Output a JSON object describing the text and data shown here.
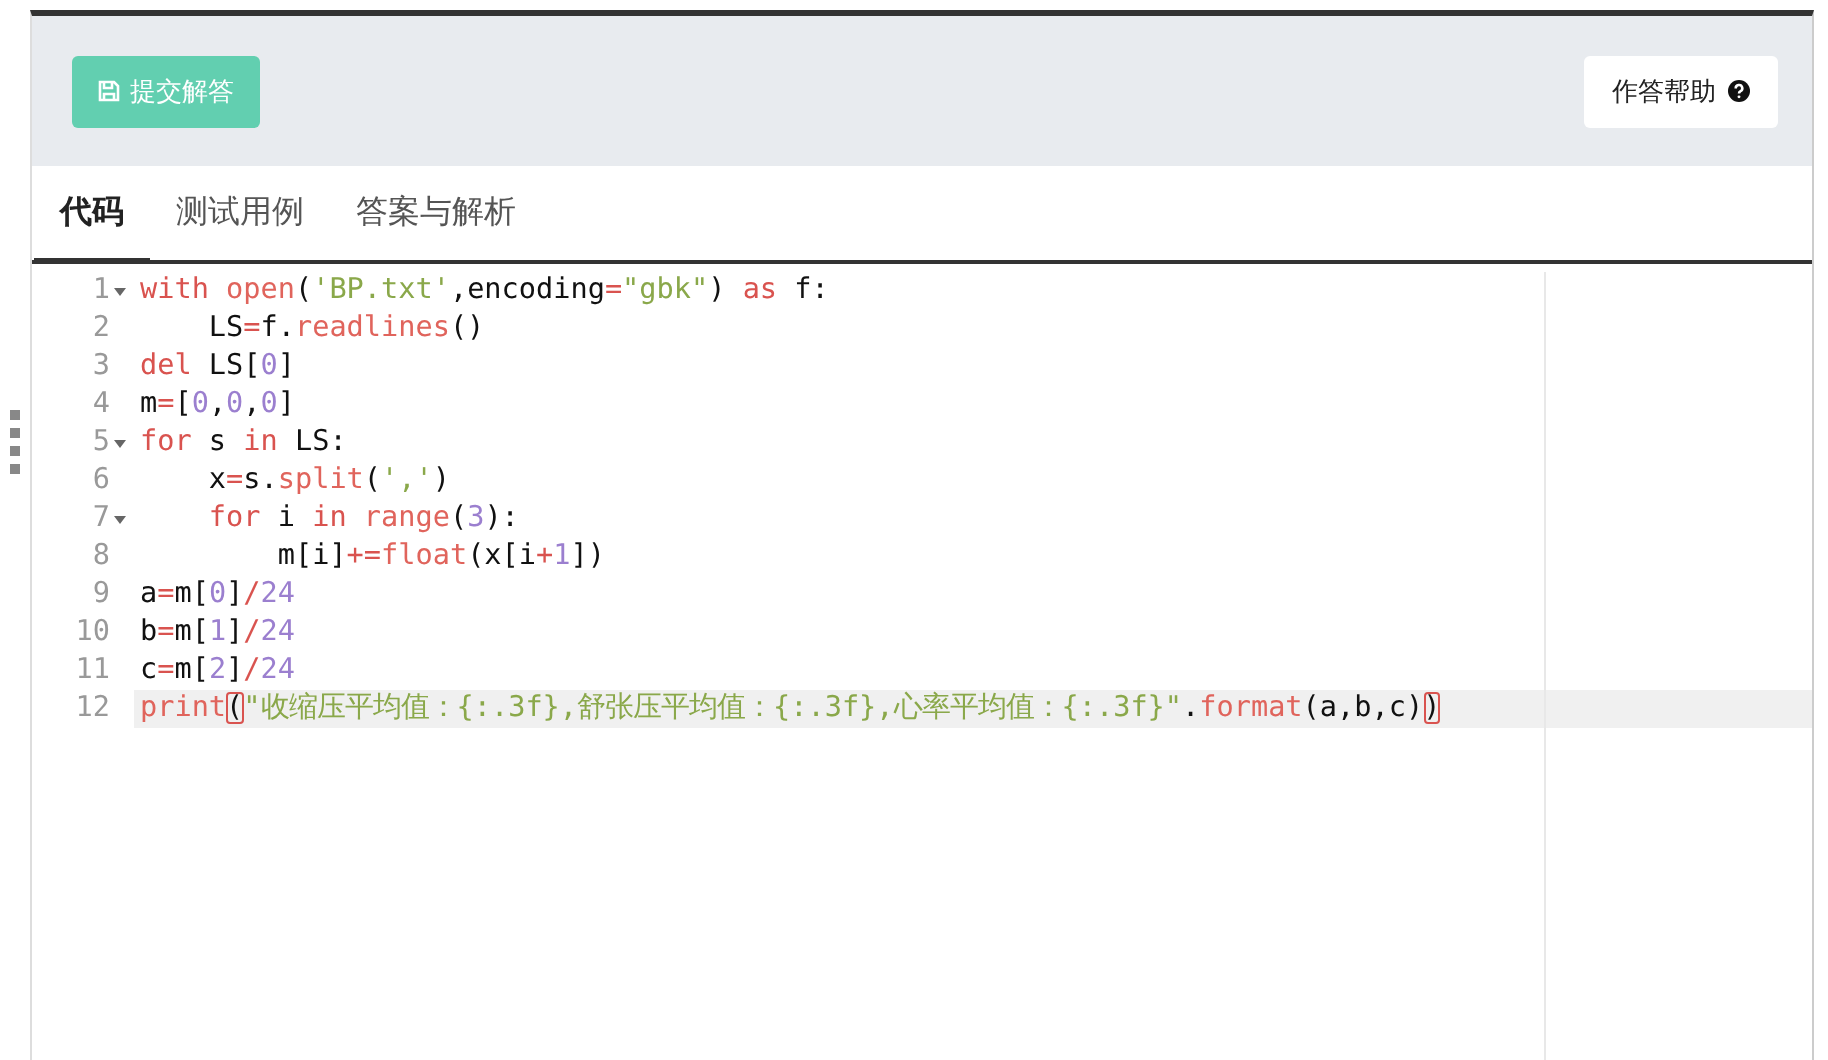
{
  "toolbar": {
    "submit_button": "提交解答",
    "help_button": "作答帮助"
  },
  "tabs": [
    {
      "label": "代码",
      "selected": true
    },
    {
      "label": "测试用例",
      "selected": false
    },
    {
      "label": "答案与解析",
      "selected": false
    }
  ],
  "editor": {
    "lines": [
      {
        "number": "1",
        "foldable": true,
        "active": false,
        "tokens": [
          {
            "kind": "keyword",
            "text": "with"
          },
          {
            "kind": "function",
            "text": " open"
          },
          {
            "kind": "plain",
            "text": "("
          },
          {
            "kind": "string",
            "text": "'BP.txt'"
          },
          {
            "kind": "plain",
            "text": ",encoding"
          },
          {
            "kind": "operator",
            "text": "="
          },
          {
            "kind": "string",
            "text": "\"gbk\""
          },
          {
            "kind": "plain",
            "text": ") "
          },
          {
            "kind": "keyword",
            "text": "as"
          },
          {
            "kind": "plain",
            "text": " f:"
          }
        ]
      },
      {
        "number": "2",
        "foldable": false,
        "active": false,
        "tokens": [
          {
            "kind": "plain",
            "text": "    LS"
          },
          {
            "kind": "operator",
            "text": "="
          },
          {
            "kind": "plain",
            "text": "f."
          },
          {
            "kind": "function",
            "text": "readlines"
          },
          {
            "kind": "plain",
            "text": "()"
          }
        ]
      },
      {
        "number": "3",
        "foldable": false,
        "active": false,
        "tokens": [
          {
            "kind": "keyword",
            "text": "del"
          },
          {
            "kind": "plain",
            "text": " LS["
          },
          {
            "kind": "number",
            "text": "0"
          },
          {
            "kind": "plain",
            "text": "]"
          }
        ]
      },
      {
        "number": "4",
        "foldable": false,
        "active": false,
        "tokens": [
          {
            "kind": "plain",
            "text": "m"
          },
          {
            "kind": "operator",
            "text": "="
          },
          {
            "kind": "plain",
            "text": "["
          },
          {
            "kind": "number",
            "text": "0"
          },
          {
            "kind": "plain",
            "text": ","
          },
          {
            "kind": "number",
            "text": "0"
          },
          {
            "kind": "plain",
            "text": ","
          },
          {
            "kind": "number",
            "text": "0"
          },
          {
            "kind": "plain",
            "text": "]"
          }
        ]
      },
      {
        "number": "5",
        "foldable": true,
        "active": false,
        "tokens": [
          {
            "kind": "keyword",
            "text": "for"
          },
          {
            "kind": "plain",
            "text": " s "
          },
          {
            "kind": "keyword",
            "text": "in"
          },
          {
            "kind": "plain",
            "text": " LS:"
          }
        ]
      },
      {
        "number": "6",
        "foldable": false,
        "active": false,
        "tokens": [
          {
            "kind": "plain",
            "text": "    x"
          },
          {
            "kind": "operator",
            "text": "="
          },
          {
            "kind": "plain",
            "text": "s."
          },
          {
            "kind": "function",
            "text": "split"
          },
          {
            "kind": "plain",
            "text": "("
          },
          {
            "kind": "string",
            "text": "','"
          },
          {
            "kind": "plain",
            "text": ")"
          }
        ]
      },
      {
        "number": "7",
        "foldable": true,
        "active": false,
        "tokens": [
          {
            "kind": "keyword",
            "text": "    for"
          },
          {
            "kind": "plain",
            "text": " i "
          },
          {
            "kind": "keyword",
            "text": "in"
          },
          {
            "kind": "function",
            "text": " range"
          },
          {
            "kind": "plain",
            "text": "("
          },
          {
            "kind": "number",
            "text": "3"
          },
          {
            "kind": "plain",
            "text": "):"
          }
        ]
      },
      {
        "number": "8",
        "foldable": false,
        "active": false,
        "tokens": [
          {
            "kind": "plain",
            "text": "        m[i]"
          },
          {
            "kind": "operator",
            "text": "+="
          },
          {
            "kind": "function",
            "text": "float"
          },
          {
            "kind": "plain",
            "text": "(x[i"
          },
          {
            "kind": "operator",
            "text": "+"
          },
          {
            "kind": "number",
            "text": "1"
          },
          {
            "kind": "plain",
            "text": "])"
          }
        ]
      },
      {
        "number": "9",
        "foldable": false,
        "active": false,
        "tokens": [
          {
            "kind": "plain",
            "text": "a"
          },
          {
            "kind": "operator",
            "text": "="
          },
          {
            "kind": "plain",
            "text": "m["
          },
          {
            "kind": "number",
            "text": "0"
          },
          {
            "kind": "plain",
            "text": "]"
          },
          {
            "kind": "operator",
            "text": "/"
          },
          {
            "kind": "number",
            "text": "24"
          }
        ]
      },
      {
        "number": "10",
        "foldable": false,
        "active": false,
        "tokens": [
          {
            "kind": "plain",
            "text": "b"
          },
          {
            "kind": "operator",
            "text": "="
          },
          {
            "kind": "plain",
            "text": "m["
          },
          {
            "kind": "number",
            "text": "1"
          },
          {
            "kind": "plain",
            "text": "]"
          },
          {
            "kind": "operator",
            "text": "/"
          },
          {
            "kind": "number",
            "text": "24"
          }
        ]
      },
      {
        "number": "11",
        "foldable": false,
        "active": false,
        "tokens": [
          {
            "kind": "plain",
            "text": "c"
          },
          {
            "kind": "operator",
            "text": "="
          },
          {
            "kind": "plain",
            "text": "m["
          },
          {
            "kind": "number",
            "text": "2"
          },
          {
            "kind": "plain",
            "text": "]"
          },
          {
            "kind": "operator",
            "text": "/"
          },
          {
            "kind": "number",
            "text": "24"
          }
        ]
      },
      {
        "number": "12",
        "foldable": false,
        "active": true,
        "tokens": [
          {
            "kind": "function",
            "text": "print"
          },
          {
            "kind": "bracket-match",
            "text": "("
          },
          {
            "kind": "string",
            "text": "\"收缩压平均值：{:.3f},舒张压平均值：{:.3f},心率平均值：{:.3f}\""
          },
          {
            "kind": "plain",
            "text": "."
          },
          {
            "kind": "function",
            "text": "format"
          },
          {
            "kind": "plain",
            "text": "(a,b,c)"
          },
          {
            "kind": "bracket-match",
            "text": ")"
          }
        ]
      }
    ]
  }
}
